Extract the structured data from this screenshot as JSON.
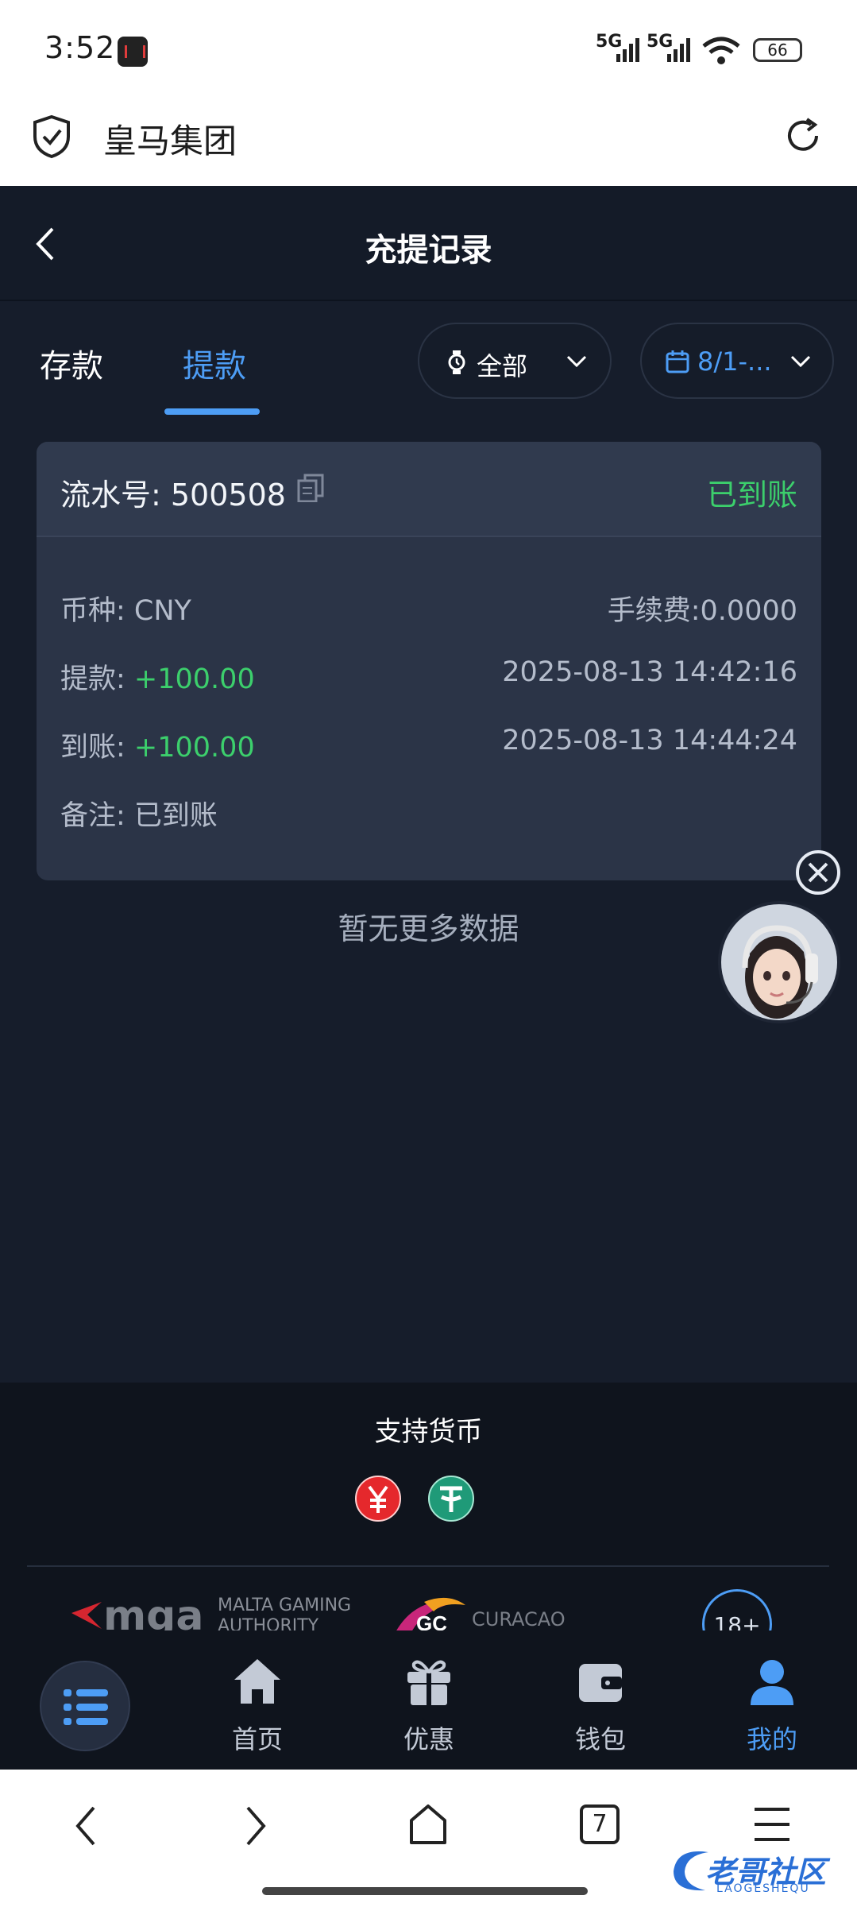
{
  "status_bar": {
    "time": "3:52",
    "signal1": "5G",
    "signal2": "5G",
    "battery": "66"
  },
  "browser": {
    "title": "皇马集团"
  },
  "header": {
    "title": "充提记录"
  },
  "tabs": [
    {
      "label": "存款"
    },
    {
      "label": "提款"
    }
  ],
  "filters": {
    "status": "全部",
    "date": "8/1-..."
  },
  "record": {
    "serial_label": "流水号: 500508",
    "status": "已到账",
    "currency": "币种: CNY",
    "fee": "手续费:0.0000",
    "withdraw_label": "提款: ",
    "withdraw_amount": "+100.00",
    "withdraw_time": "2025-08-13 14:42:16",
    "arrive_label": "到账: ",
    "arrive_amount": "+100.00",
    "arrive_time": "2025-08-13 14:44:24",
    "note": "备注: 已到账"
  },
  "no_more": "暂无更多数据",
  "footer": {
    "currency_title": "支持货币",
    "currency_icons": [
      "yuan-icon",
      "tether-icon"
    ],
    "licenses": {
      "mga_logo": "mga",
      "mga_text1": "MALTA GAMING",
      "mga_text2": "AUTHORITY",
      "gc_text": "CURACAO",
      "age": "18+"
    }
  },
  "nav": [
    {
      "label": "",
      "icon": "menu-icon"
    },
    {
      "label": "首页",
      "icon": "home-icon"
    },
    {
      "label": "优惠",
      "icon": "gift-icon"
    },
    {
      "label": "钱包",
      "icon": "wallet-icon"
    },
    {
      "label": "我的",
      "icon": "user-icon",
      "active": true
    }
  ],
  "system_bar": {
    "tab_count": "7"
  },
  "watermark": {
    "text": "老哥社区",
    "sub": "LAOGESHEQU"
  },
  "colors": {
    "accent": "#4d9df5",
    "success": "#3ccf6c",
    "background": "#161d2b",
    "card": "#2b3447"
  }
}
